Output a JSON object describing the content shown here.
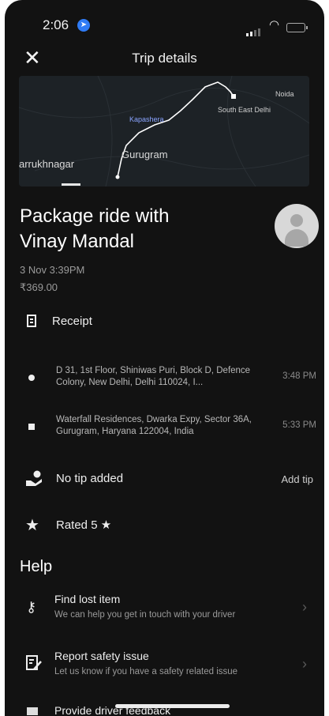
{
  "status_bar": {
    "time": "2:06"
  },
  "header": {
    "close_symbol": "✕",
    "title": "Trip details"
  },
  "map": {
    "labels": {
      "noida": "Noida",
      "south_east_delhi": "South East Delhi",
      "kapashera": "Kapashera",
      "gurugram": "Gurugram",
      "farrukhnagar": "arrukhnagar"
    }
  },
  "trip": {
    "heading_line1": "Package ride with",
    "heading_line2": "Vinay Mandal",
    "date": "3 Nov 3:39PM",
    "fare": "₹369.00",
    "receipt_label": "Receipt"
  },
  "stops": [
    {
      "address": "D 31, 1st Floor, Shiniwas Puri, Block D, Defence Colony, New Delhi, Delhi 110024, I...",
      "time": "3:48 PM"
    },
    {
      "address": "Waterfall Residences, Dwarka Expy, Sector 36A, Gurugram, Haryana 122004, India",
      "time": "5:33 PM"
    }
  ],
  "tip": {
    "label": "No tip added",
    "action": "Add tip"
  },
  "rating": {
    "label": "Rated 5 ★"
  },
  "help": {
    "heading": "Help",
    "items": [
      {
        "title": "Find lost item",
        "subtitle": "We can help you get in touch with your driver"
      },
      {
        "title": "Report safety issue",
        "subtitle": "Let us know if you have a safety related issue"
      },
      {
        "title": "Provide driver feedback"
      }
    ]
  },
  "colors": {
    "background": "#121212",
    "map_route": "#ffffff",
    "status_location": "#2f7bf5"
  }
}
